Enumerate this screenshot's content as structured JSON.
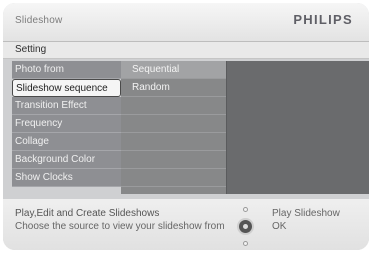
{
  "header": {
    "title": "Slideshow",
    "brand": "PHILIPS"
  },
  "section": {
    "label": "Setting"
  },
  "menu": {
    "items": [
      {
        "label": "Photo from"
      },
      {
        "label": "Slideshow sequence"
      },
      {
        "label": "Transition Effect"
      },
      {
        "label": "Frequency"
      },
      {
        "label": "Collage"
      },
      {
        "label": "Background Color"
      },
      {
        "label": "Show Clocks"
      }
    ],
    "selected_index": 1
  },
  "submenu": {
    "options": [
      {
        "label": "Sequential"
      },
      {
        "label": "Random"
      }
    ],
    "selected_index": 0
  },
  "footer": {
    "help_line1": "Play,Edit and Create Slideshows",
    "help_line2": "Choose the source to view your slideshow from",
    "play_label": "Play Slideshow",
    "ok_label": "OK"
  },
  "colors": {
    "menu_bg": "#8e8f93",
    "menu_selected_bg": "#f5f5f5",
    "submenu_bg": "#878889",
    "preview_bg": "#6a6b6d",
    "brand": "#5f5f66"
  }
}
